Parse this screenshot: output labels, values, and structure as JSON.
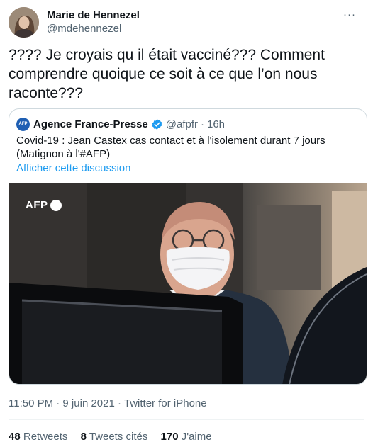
{
  "tweet": {
    "author": {
      "name": "Marie de Hennezel",
      "handle": "@mdehennezel"
    },
    "more_label": "···",
    "text": "???? Je croyais qu il était vacciné??? Comment comprendre quoique ce soit à ce que l’on nous raconte???",
    "quoted": {
      "logo_text": "AFP",
      "name": "Agence France-Presse",
      "handle": "@afpfr",
      "separator": "·",
      "time": "16h",
      "text": "Covid-19 : Jean Castex cas contact et à l'isolement durant 7 jours (Matignon à l'#AFP)",
      "link": "Afficher cette discussion",
      "image_watermark": "AFP",
      "brand_color": "#1f5fb3"
    },
    "meta": "11:50 PM · 9 juin 2021 · Twitter for iPhone",
    "stats": {
      "retweets_count": "48",
      "retweets_label": "Retweets",
      "quotes_count": "8",
      "quotes_label": "Tweets cités",
      "likes_count": "170",
      "likes_label": "J'aime"
    }
  },
  "colors": {
    "text": "#0f1419",
    "secondary": "#536471",
    "link": "#1d9bf0",
    "border": "#cfd9de"
  }
}
